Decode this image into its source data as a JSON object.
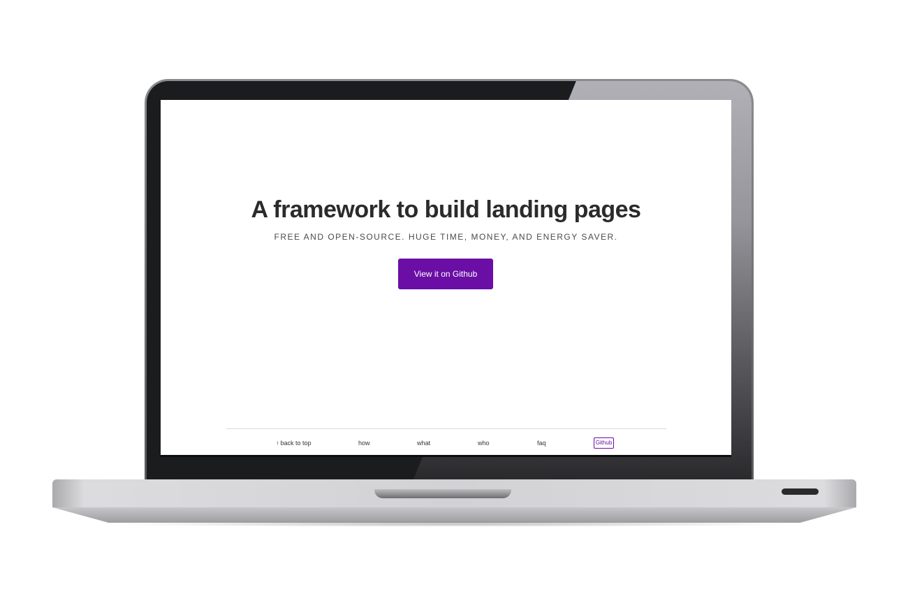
{
  "hero": {
    "title": "A framework to build landing pages",
    "subtitle": "FREE AND OPEN-SOURCE. HUGE TIME, MONEY, AND ENERGY SAVER.",
    "cta_label": "View it on Github"
  },
  "footer_nav": {
    "back_to_top_icon": "arrow-up-icon",
    "back_to_top_glyph": "↑",
    "back_to_top": "back to top",
    "how": "how",
    "what": "what",
    "who": "who",
    "faq": "faq",
    "github": "Github"
  },
  "colors": {
    "accent": "#6a0ea5",
    "title_text": "#2b2b2b",
    "laptop_bezel": "#1b1c1e",
    "laptop_aluminum": "#d2d2d4"
  }
}
